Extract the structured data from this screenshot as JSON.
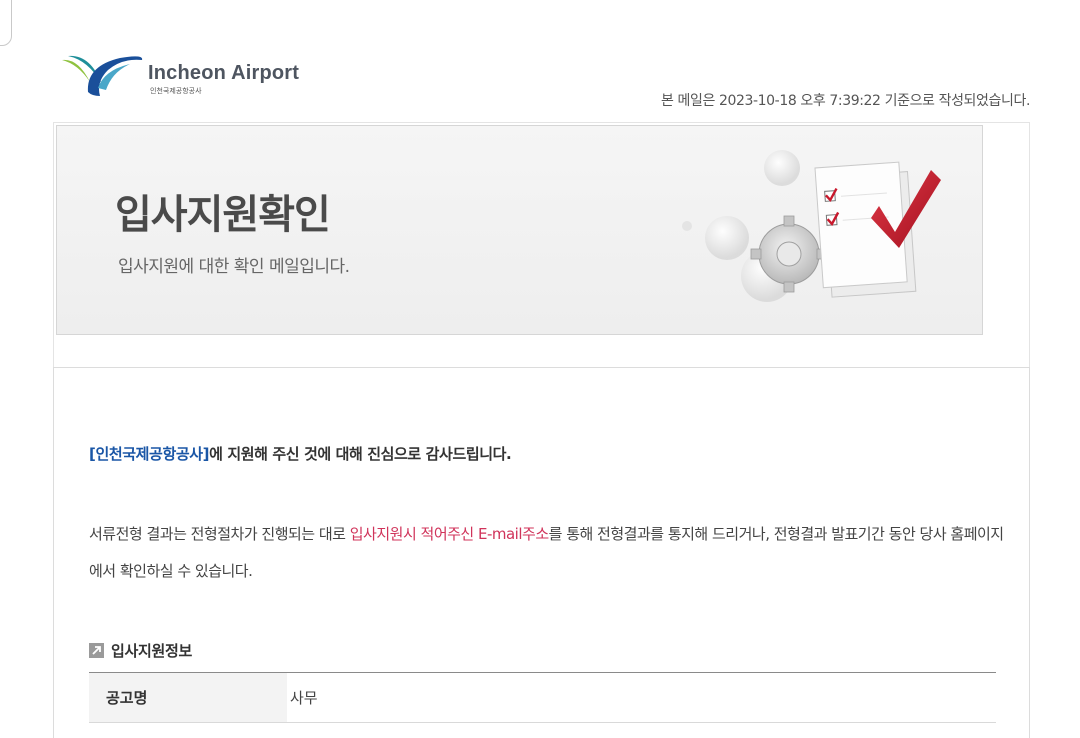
{
  "logo": {
    "name_en": "Incheon Airport",
    "name_ko": "인천국제공항공사"
  },
  "mail_date": "본 메일은 2023-10-18 오후 7:39:22 기준으로 작성되었습니다.",
  "banner": {
    "title": "입사지원확인",
    "subtitle": "입사지원에 대한 확인 메일입니다."
  },
  "message": {
    "org_name": "[인천국제공항공사]",
    "thanks": "에 지원해 주신 것에 대해 진심으로 감사드립니다.",
    "body_before": "서류전형 결과는 전형절차가 진행되는 대로 ",
    "body_highlight": "입사지원시 적어주신 E-mail주소",
    "body_after": "를 통해 전형결과를 통지해 드리거나, 전형결과 발표기간 동안 당사 홈페이지에서 확인하실 수 있습니다."
  },
  "section": {
    "title": "입사지원정보",
    "icon": "arrow-box-icon"
  },
  "info_table": {
    "rows": [
      {
        "label": "공고명",
        "value": "사무"
      }
    ]
  },
  "colors": {
    "link_blue": "#1a56a6",
    "highlight_red": "#d0335a",
    "check_red": "#c8182c"
  }
}
